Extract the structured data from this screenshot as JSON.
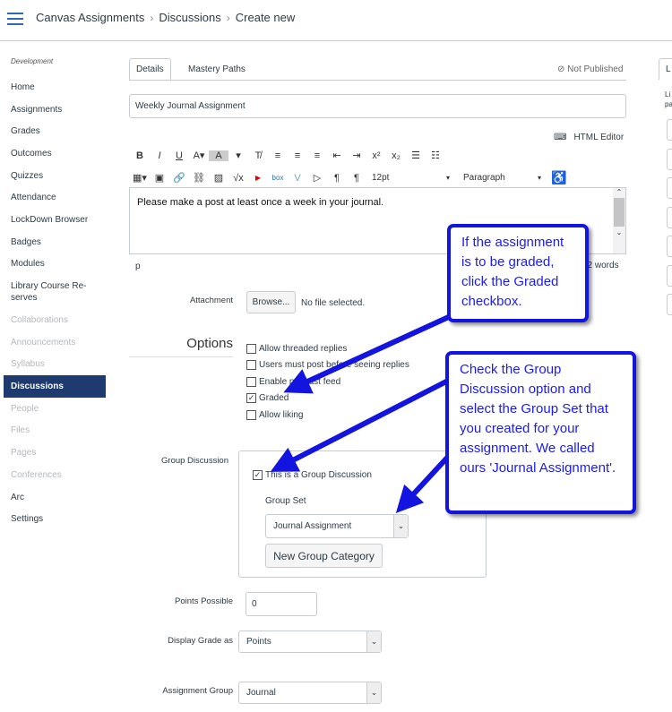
{
  "breadcrumb": [
    "Canvas Assignments",
    "Discussions",
    "Create new"
  ],
  "sidebar": {
    "context": "Development",
    "items": [
      {
        "label": "Home",
        "state": "normal"
      },
      {
        "label": "Assignments",
        "state": "normal"
      },
      {
        "label": "Grades",
        "state": "normal"
      },
      {
        "label": "Outcomes",
        "state": "normal"
      },
      {
        "label": "Quizzes",
        "state": "normal"
      },
      {
        "label": "Attendance",
        "state": "normal"
      },
      {
        "label": "LockDown Browser",
        "state": "normal"
      },
      {
        "label": "Badges",
        "state": "normal"
      },
      {
        "label": "Modules",
        "state": "normal"
      },
      {
        "label": "Library Course Re-serves",
        "state": "normal"
      },
      {
        "label": "Collaborations",
        "state": "disabled"
      },
      {
        "label": "Announcements",
        "state": "disabled"
      },
      {
        "label": "Syllabus",
        "state": "disabled"
      },
      {
        "label": "Discussions",
        "state": "active"
      },
      {
        "label": "People",
        "state": "disabled"
      },
      {
        "label": "Files",
        "state": "disabled"
      },
      {
        "label": "Pages",
        "state": "disabled"
      },
      {
        "label": "Conferences",
        "state": "disabled"
      },
      {
        "label": "Arc",
        "state": "normal"
      },
      {
        "label": "Settings",
        "state": "normal"
      }
    ]
  },
  "tabs": [
    "Details",
    "Mastery Paths"
  ],
  "status": "Not Published",
  "title_value": "Weekly Journal Assignment",
  "html_editor": "HTML Editor",
  "editor": {
    "font_size": "12pt",
    "block": "Paragraph",
    "body": "Please make a post at least once a week in your journal.",
    "path": "p",
    "word_count": "12 words"
  },
  "attachment": {
    "label": "Attachment",
    "button": "Browse...",
    "status": "No file selected."
  },
  "options": {
    "heading": "Options",
    "items": [
      {
        "label": "Allow threaded replies",
        "checked": false
      },
      {
        "label": "Users must post before seeing replies",
        "checked": false
      },
      {
        "label": "Enable podcast feed",
        "checked": false
      },
      {
        "label": "Graded",
        "checked": true
      },
      {
        "label": "Allow liking",
        "checked": false
      }
    ]
  },
  "group": {
    "label": "Group Discussion",
    "checkbox": "This is a Group Discussion",
    "checked": true,
    "set_label": "Group Set",
    "set_value": "Journal Assignment",
    "new_button": "New Group Category"
  },
  "points": {
    "label": "Points Possible",
    "value": "0"
  },
  "display_grade": {
    "label": "Display Grade as",
    "value": "Points"
  },
  "assignment_group": {
    "label": "Assignment Group",
    "value": "Journal"
  },
  "right_panel": {
    "tab": "L",
    "text1": "Li",
    "text2": "pa"
  },
  "callouts": {
    "graded": "If the assignment is to be graded, click the Graded checkbox.",
    "group": "Check the Group Discussion option and select the Group Set that you created for your assignment. We called ours 'Journal Assignment'."
  },
  "colors": {
    "accent": "#1414e0",
    "nav_active": "#1e3a6e"
  }
}
